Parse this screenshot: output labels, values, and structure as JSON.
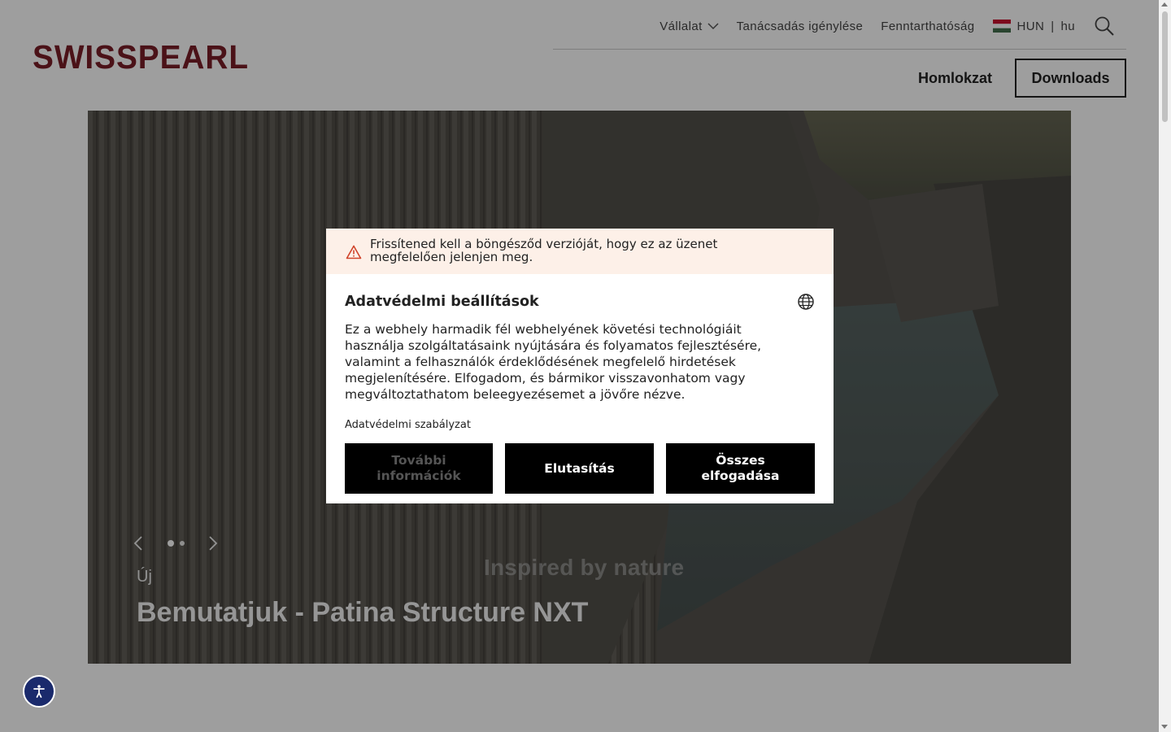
{
  "brand": {
    "logo_text": "SWISSPEARL",
    "logo_color": "#7a1e28"
  },
  "topnav": {
    "company": "Vállalat",
    "consulting": "Tanácsadás igénylése",
    "sustainability": "Fenntarthatóság",
    "country": "HUN",
    "lang": "hu",
    "country_sep": "|"
  },
  "mainnav": {
    "facade": "Homlokzat",
    "downloads": "Downloads"
  },
  "hero": {
    "tag": "Új",
    "title": "Bemutatjuk - Patina Structure NXT",
    "watermark": "Inspired by nature",
    "slide_count": 2,
    "active_slide": 1
  },
  "consent": {
    "warning": "Frissítened kell a böngésződ verzióját, hogy ez az üzenet megfelelően jelenjen meg.",
    "title": "Adatvédelmi beállítások",
    "body": "Ez a webhely harmadik fél webhelyének követési technológiáit használja szolgáltatásaink nyújtására és folyamatos fejlesztésére, valamint a felhasználók érdeklődésének megfelelő hirdetések megjelenítésére. Elfogadom, és bármikor visszavonhatom vagy megváltoztathatom beleegyezésemet a jövőre nézve.",
    "policy_link": "Adatvédelmi szabályzat",
    "more_info": "További információk",
    "decline": "Elutasítás",
    "accept_all": "Összes elfogadása"
  },
  "icons": [
    "chevron-down-icon",
    "hungary-flag-icon",
    "search-icon",
    "prev-arrow-icon",
    "next-arrow-icon",
    "warning-icon",
    "globe-icon",
    "accessibility-icon"
  ]
}
